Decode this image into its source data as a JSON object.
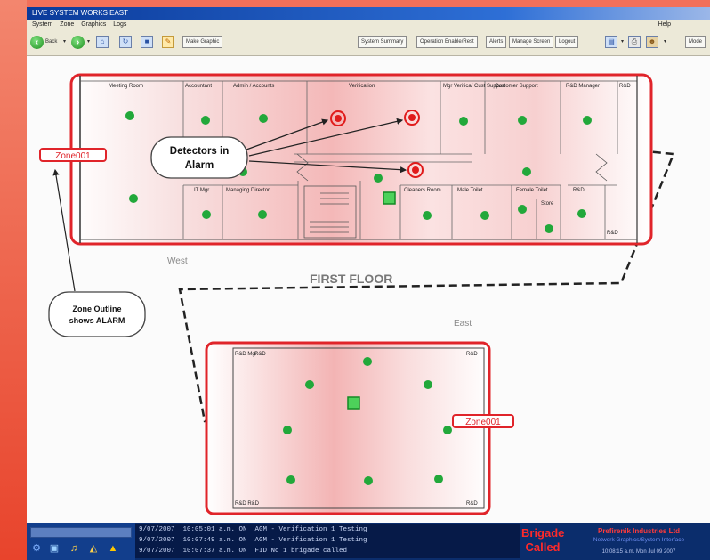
{
  "window": {
    "title": "LIVE SYSTEM WORKS EAST"
  },
  "menu": {
    "items": [
      "System",
      "Zone",
      "Graphics",
      "Logs"
    ],
    "help": "Help"
  },
  "toolbar": {
    "back": "Back",
    "zone_btn": "Make Graphic",
    "right_buttons": [
      "System Summary",
      "Operation Enable/Rest",
      "Alerts",
      "Manage Screen",
      "Logout"
    ],
    "end_btn": "Mode"
  },
  "plan": {
    "upper_rooms": [
      "Meeting Room",
      "Accountant",
      "Admin / Accounts",
      "Verification",
      "Mgr Verifica/ Cust Support",
      "Customer Support",
      "R&D Manager",
      "R&D"
    ],
    "lower_rooms": [
      "IT Mgr",
      "Managing Director",
      "Cleaners Room",
      "Male Toilet",
      "Female Toilet",
      "Store",
      "R&D"
    ],
    "corner_label": "R&D",
    "west": "West",
    "east": "East",
    "floor": "FIRST FLOOR",
    "zone_west": "Zone001",
    "zone_east": "Zone001",
    "callout_detectors": [
      "Detectors in",
      "Alarm"
    ],
    "callout_zone": [
      "Zone Outline",
      "shows ALARM"
    ],
    "east_labels": [
      "R&D Mgr",
      "R&D",
      "R&D",
      "R&D R&D",
      "R&D"
    ],
    "colors": {
      "alarm": "#e01b1b",
      "detector_ok": "#22a83a"
    }
  },
  "status": {
    "log_lines": [
      "9/07/2007  10:05:01 a.m. ON  AGM - Verification 1 Testing",
      "9/07/2007  10:07:49 a.m. ON  AGM - Verification 1 Testing",
      "9/07/2007  10:07:37 a.m. ON  FID No 1 brigade called"
    ],
    "brigade": [
      "Brigade",
      "Called"
    ],
    "company": "Prefirenik Industries Ltd",
    "subtitle": "Network Graphics/System Interface",
    "clock": "10:08:15 a.m.   Mon Jul 09 2007"
  }
}
